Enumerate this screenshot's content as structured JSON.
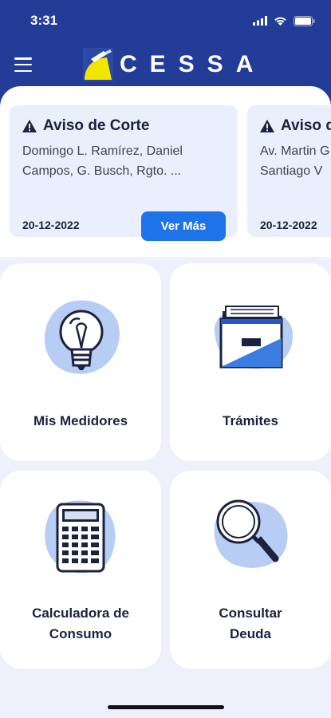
{
  "status": {
    "time": "3:31"
  },
  "app": {
    "brand_name": "CESSA"
  },
  "notices": [
    {
      "title": "Aviso de Corte",
      "body_line1": "Domingo L. Ramírez, Daniel",
      "body_line2": "Campos, G. Busch, Rgto. ...",
      "date": "20-12-2022",
      "button_label": "Ver Más"
    },
    {
      "title": "Aviso de Corte",
      "body_line1": "Av. Martin G",
      "body_line2": "Santiago V",
      "date": "20-12-2022"
    }
  ],
  "tiles": [
    {
      "label_line1": "Mis Medidores",
      "label_line2": "",
      "icon": "lightbulb-icon"
    },
    {
      "label_line1": "Trámites",
      "label_line2": "",
      "icon": "folder-icon"
    },
    {
      "label_line1": "Calculadora de",
      "label_line2": "Consumo",
      "icon": "calculator-icon"
    },
    {
      "label_line1": "Consultar",
      "label_line2": "Deuda",
      "icon": "magnifier-icon"
    }
  ],
  "colors": {
    "header": "#233c98",
    "accent": "#1d73e8",
    "background": "#eef1fb",
    "card": "#eaf0fb",
    "logo_yellow": "#f2e600"
  }
}
